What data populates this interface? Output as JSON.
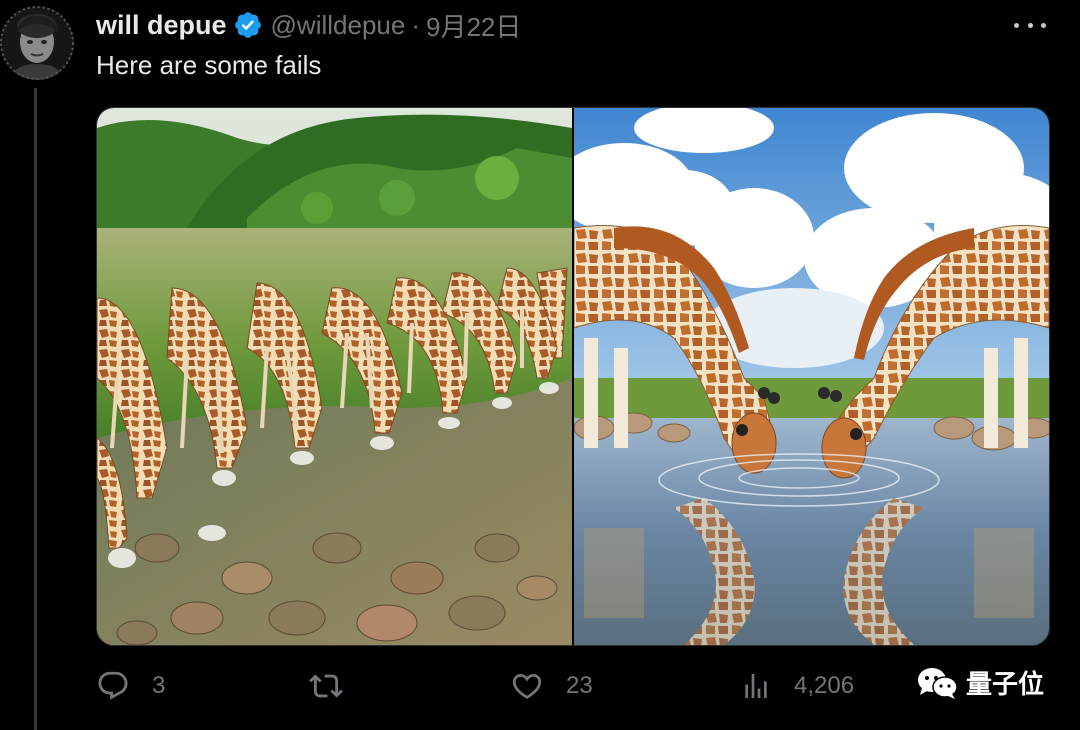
{
  "tweet": {
    "author_name": "will depue",
    "handle": "@willdepue",
    "separator": "·",
    "date": "9月22日",
    "text": "Here are some fails"
  },
  "icons": {
    "verified": "verified-badge-icon",
    "more": "more-options-icon",
    "reply": "reply-icon",
    "retweet": "retweet-icon",
    "like": "like-icon",
    "views": "views-icon"
  },
  "media": [
    {
      "name": "image-left"
    },
    {
      "name": "image-right"
    }
  ],
  "actions": {
    "reply_count": "3",
    "retweet_count": "",
    "like_count": "23",
    "views_count": "4,206"
  },
  "watermark": {
    "text": "量子位"
  },
  "colors": {
    "background": "#000000",
    "text": "#e7e9ea",
    "muted": "#71767b",
    "verified": "#1d9bf0"
  }
}
